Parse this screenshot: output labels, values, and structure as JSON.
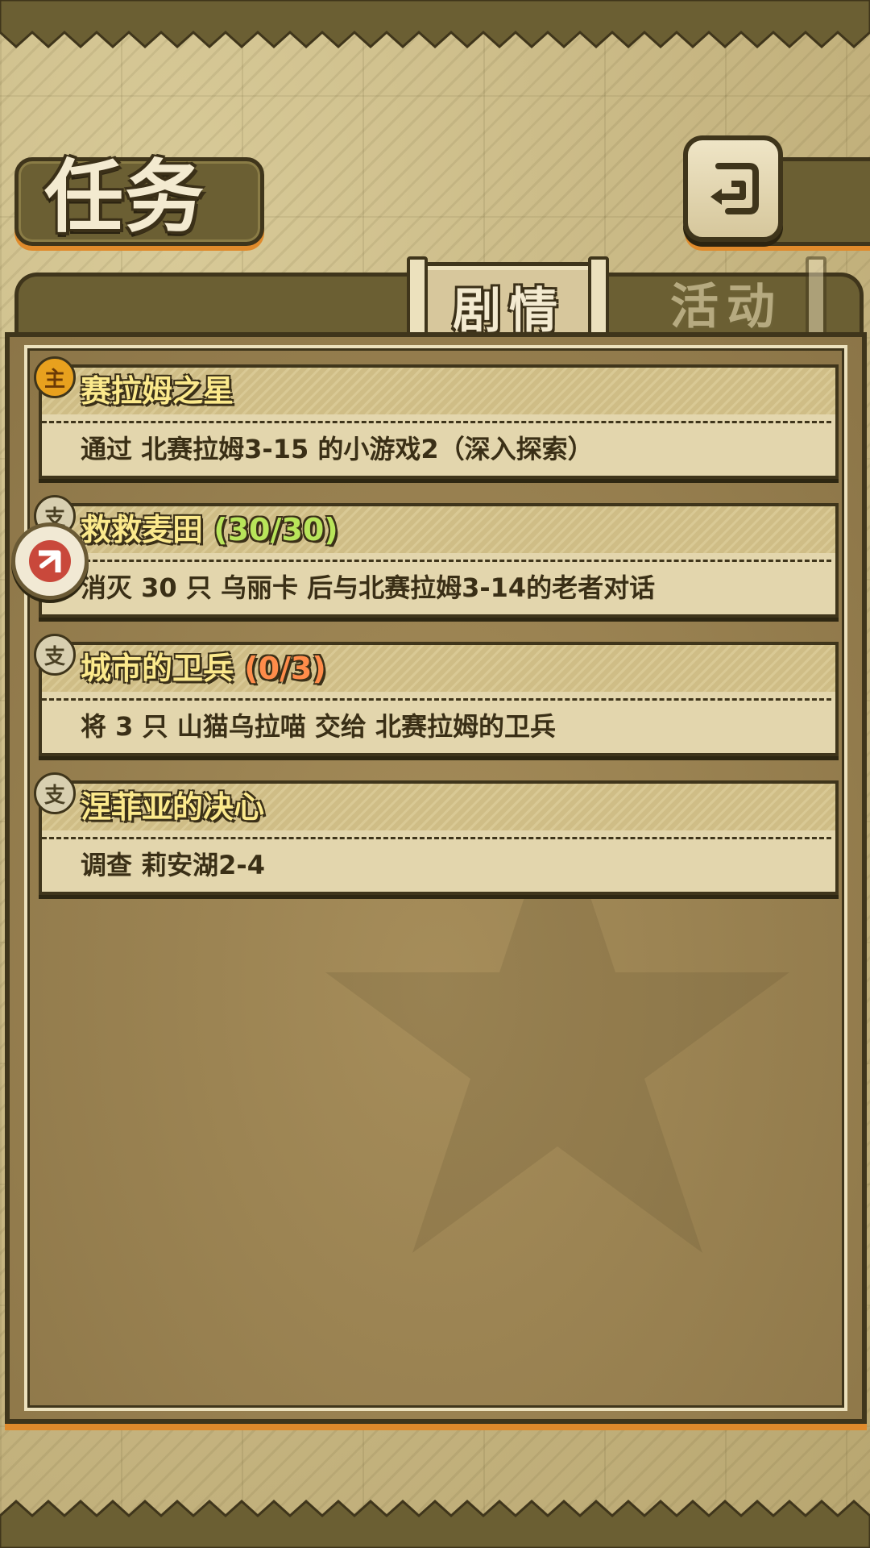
{
  "screen": {
    "title": "任务",
    "back_icon": "return-arrow-icon"
  },
  "tabs": [
    {
      "label": "剧情",
      "active": true
    },
    {
      "label": "活动",
      "active": false
    }
  ],
  "quests": [
    {
      "badge": "主",
      "badge_type": "main",
      "title": "赛拉姆之星",
      "progress": "",
      "description": "通过 北赛拉姆3-15 的小游戏2（深入探索）"
    },
    {
      "badge": "支",
      "badge_type": "side",
      "title": "救救麦田",
      "progress": "(30/30)",
      "progress_state": "complete",
      "description": "消灭 30 只 乌丽卡 后与北赛拉姆3-14的老者对话"
    },
    {
      "badge": "支",
      "badge_type": "side",
      "title": "城市的卫兵",
      "progress": "(0/3)",
      "progress_state": "incomplete",
      "description": "将 3 只 山猫乌拉喵 交给 北赛拉姆的卫兵"
    },
    {
      "badge": "支",
      "badge_type": "side",
      "title": "涅菲亚的决心",
      "progress": "",
      "description": "调查 莉安湖2-4"
    }
  ],
  "colors": {
    "frame_dark": "#3f351b",
    "frame_olive": "#6b5f33",
    "accent_orange": "#e08a2b",
    "title_yellow": "#fbe98c",
    "progress_complete": "#b8e55a",
    "progress_incomplete": "#ff8c4a"
  },
  "icons": {
    "quest_pin": "navigate-arrow-icon"
  }
}
